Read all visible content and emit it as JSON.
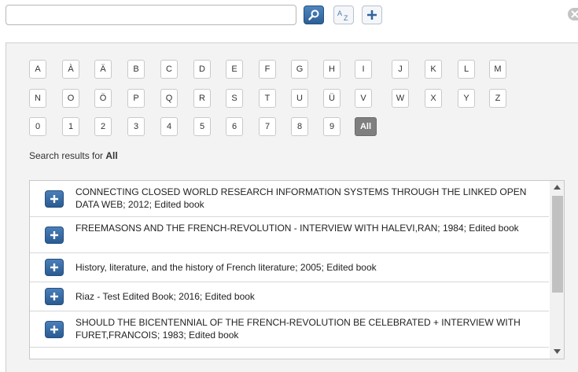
{
  "search": {
    "value": "",
    "placeholder": ""
  },
  "toolbar": {
    "search_icon": "magnifier-icon",
    "sort_icon": "sort-az-icon",
    "sort_icon_text_a": "A",
    "sort_icon_text_z": "Z",
    "add_icon": "plus-icon",
    "close_icon": "close-icon"
  },
  "alphabet": {
    "row1": [
      "A",
      "À",
      "Ä",
      "B",
      "C",
      "D",
      "E",
      "F",
      "G",
      "H",
      "I",
      "J",
      "K",
      "L",
      "M"
    ],
    "row2": [
      "N",
      "O",
      "Ö",
      "P",
      "Q",
      "R",
      "S",
      "T",
      "U",
      "Ü",
      "V",
      "W",
      "X",
      "Y",
      "Z"
    ],
    "row3": [
      "0",
      "1",
      "2",
      "3",
      "4",
      "5",
      "6",
      "7",
      "8",
      "9",
      "All"
    ],
    "active": "All"
  },
  "results_heading": {
    "prefix": "Search results for",
    "term": "All"
  },
  "results": [
    {
      "text": "CONNECTING CLOSED WORLD RESEARCH INFORMATION SYSTEMS THROUGH THE LINKED OPEN DATA WEB; 2012; Edited book"
    },
    {
      "text": "FREEMASONS AND THE FRENCH-REVOLUTION - INTERVIEW WITH HALEVI,RAN; 1984; Edited book"
    },
    {
      "text": "History, literature, and the history of French literature; 2005; Edited book"
    },
    {
      "text": "Riaz - Test Edited Book; 2016; Edited book"
    },
    {
      "text": "SHOULD THE BICENTENNIAL OF THE FRENCH-REVOLUTION BE CELEBRATED + INTERVIEW WITH FURET,FRANCOIS; 1983; Edited book"
    },
    {
      "text": ""
    }
  ],
  "colors": {
    "accent": "#2c5f95",
    "active_letter": "#7f7f7f",
    "panel_bg": "#f3f3f3"
  }
}
